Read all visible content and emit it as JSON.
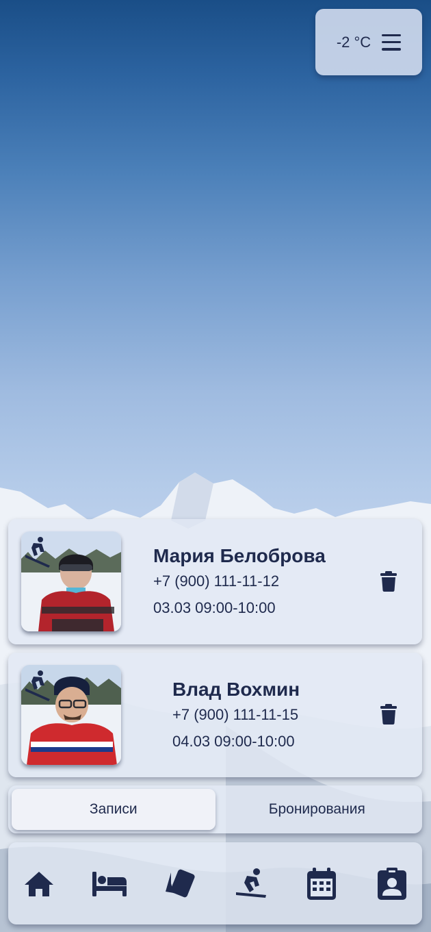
{
  "weather": {
    "temperature": "-2 °C",
    "icon": "menu-icon"
  },
  "appointments": [
    {
      "name": "Мария Белоброва",
      "phone": "+7 (900) 111-11-12",
      "time": "03.03 09:00-10:00",
      "badge_icon": "skier-icon",
      "action_icon": "trash-icon"
    },
    {
      "name": "Влад Вохмин",
      "phone": "+7 (900) 111-11-15",
      "time": "04.03 09:00-10:00",
      "badge_icon": "skier-icon",
      "action_icon": "trash-icon"
    }
  ],
  "tabs": [
    {
      "label": "Записи",
      "active": true
    },
    {
      "label": "Бронирования",
      "active": false
    }
  ],
  "bottom_nav": [
    {
      "icon": "home-icon"
    },
    {
      "icon": "bed-icon"
    },
    {
      "icon": "ski-pass-icon"
    },
    {
      "icon": "snowboard-icon"
    },
    {
      "icon": "calendar-icon"
    },
    {
      "icon": "profile-badge-icon"
    }
  ],
  "colors": {
    "primary": "#1f2a4d",
    "panel": "#e2e8f4",
    "sky_top": "#1a4e87"
  }
}
